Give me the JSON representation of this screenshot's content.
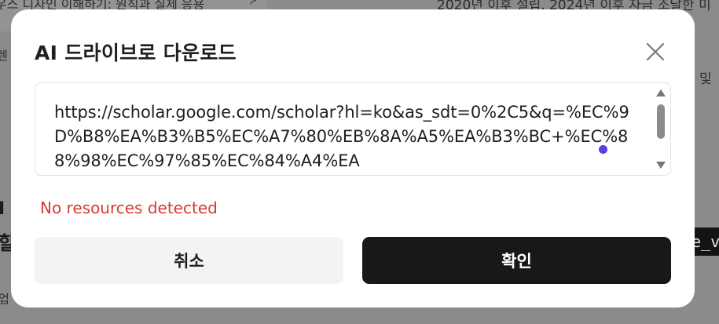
{
  "background": {
    "line1": "우스 디자인 이해하기: 원칙과 실제 응용",
    "line1_icon": "external-link-icon",
    "line2": "2020년 이후 설립, 2024년 이후 자금 조달한 미",
    "line3": "렌",
    "line4": "및",
    "line5": "I",
    "line6": "할",
    "line7": "업",
    "code_snippet": "e_v"
  },
  "modal": {
    "title": "AI 드라이브로 다운로드",
    "close_icon": "close-icon",
    "url_value": "https://scholar.google.com/scholar?hl=ko&as_sdt=0%2C5&q=%EC%9D%B8%EA%B3%B5%EC%A7%80%EB%8A%A5%EA%B3%BC+%EC%88%98%EC%97%85%EC%84%A4%EA",
    "error_message": "No resources detected",
    "cancel_label": "취소",
    "confirm_label": "확인"
  },
  "colors": {
    "error": "#d83a36",
    "confirm_bg": "#181818",
    "cancel_bg": "#f3f3f3",
    "cursor": "#5a3ee6"
  }
}
